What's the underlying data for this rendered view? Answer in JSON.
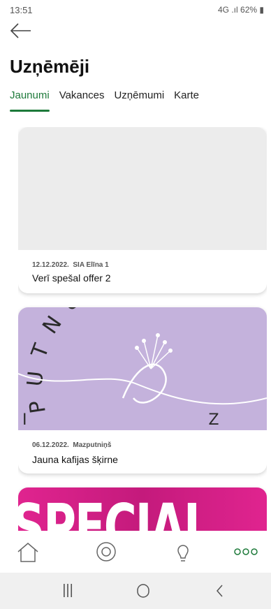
{
  "status_bar": {
    "time": "13:51",
    "signal": "4G",
    "battery": "62%"
  },
  "header": {
    "title": "Uzņēmēji"
  },
  "tabs": [
    {
      "label": "Jaunumi",
      "active": true
    },
    {
      "label": "Vakances",
      "active": false
    },
    {
      "label": "Uzņēmumi",
      "active": false
    },
    {
      "label": "Karte",
      "active": false
    }
  ],
  "cards": [
    {
      "date": "12.12.2022.",
      "company": "SIA Elīna 1",
      "title": "Verī spešal offer 2",
      "image": "placeholder"
    },
    {
      "date": "06.12.2022.",
      "company": "Mazputniņš",
      "title": "Jauna kafijas šķirne",
      "image": "putnu-logo",
      "image_text_top": "PUTNU NAMS",
      "image_text_bottom": "IZA ETA"
    },
    {
      "image": "special-banner",
      "image_text": "SPECIAL"
    }
  ],
  "bottom_nav": [
    {
      "icon": "home-icon"
    },
    {
      "icon": "location-icon"
    },
    {
      "icon": "lightbulb-icon"
    },
    {
      "icon": "more-icon"
    }
  ],
  "colors": {
    "accent": "#1d7a3a",
    "card_placeholder": "#ececec",
    "lavender": "#c4b2dc",
    "special_bg": "#e0248f"
  }
}
